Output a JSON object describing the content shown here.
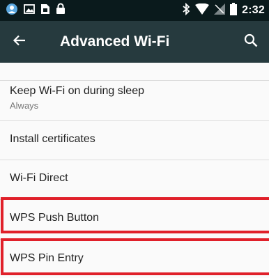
{
  "status_bar": {
    "time": "2:32",
    "icons": [
      "avatar-icon",
      "image-icon",
      "sim-card-icon",
      "lock-icon",
      "bluetooth-icon",
      "wifi-icon",
      "no-signal-icon",
      "battery-icon"
    ]
  },
  "app_bar": {
    "title": "Advanced Wi-Fi",
    "back_icon": "arrow-left-icon",
    "search_icon": "search-icon"
  },
  "settings": [
    {
      "label": "Keep Wi-Fi on during sleep",
      "value": "Always"
    },
    {
      "label": "Install certificates"
    },
    {
      "label": "Wi-Fi Direct"
    },
    {
      "label": "WPS Push Button",
      "highlighted": true
    },
    {
      "label": "WPS Pin Entry",
      "highlighted": true
    }
  ],
  "colors": {
    "status_bar": "#0a1a1c",
    "app_bar": "#263a3e",
    "highlight": "#e0202a"
  }
}
